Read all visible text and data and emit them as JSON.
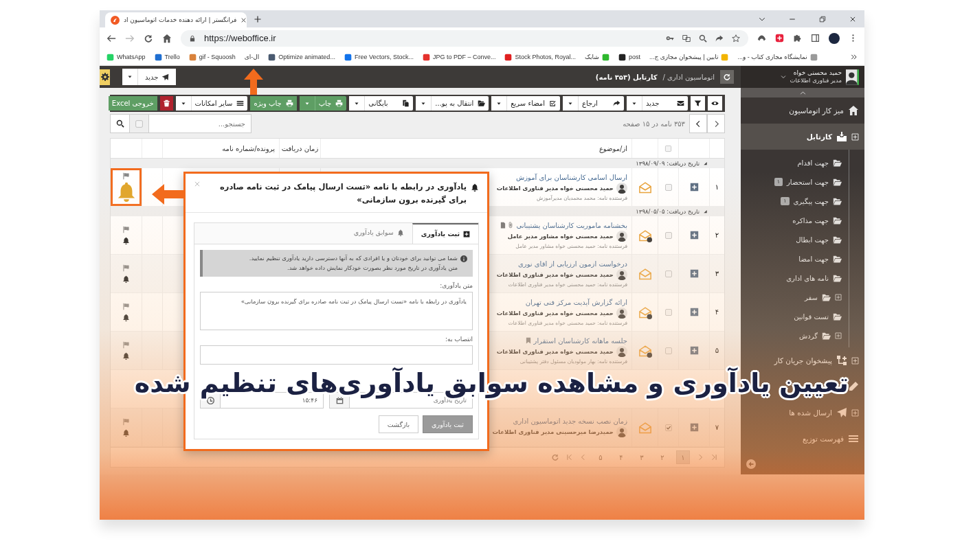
{
  "browser": {
    "tab": {
      "title": "فرانگستر | ارائه دهنده خدمات اتوماسیون اد",
      "selected": true
    },
    "url": "https://weboffice.ir",
    "bookmarks": [
      {
        "label": "نمایشگاه مجازی کتاب - و...",
        "color": "#9a9a9a"
      },
      {
        "label": "تابین | پیشخوان مجازی ج...",
        "color": "#f2b400"
      },
      {
        "label": "post",
        "color": "#222222"
      },
      {
        "label": "شابک",
        "color": "#2eb82e"
      },
      {
        "label": "Stock Photos, Royal...",
        "color": "#e02020"
      },
      {
        "label": "JPG to PDF – Conve...",
        "color": "#e5322d"
      },
      {
        "label": "Free Vectors, Stock...",
        "color": "#1273eb"
      },
      {
        "label": "Optimize animated...",
        "color": "#4a5a70"
      },
      {
        "label": "ال-ای"
      },
      {
        "label": "gif - Squoosh",
        "color": "#d9823b"
      },
      {
        "label": "Trello",
        "color": "#1f6fd1"
      },
      {
        "label": "WhatsApp",
        "color": "#25d366"
      }
    ]
  },
  "app": {
    "user": {
      "name": "حمید محسنی خواه",
      "role": "مدیر فناوری اطلاعات"
    },
    "new_button": {
      "label": "جدید"
    },
    "breadcrumb": {
      "parent": "اتوماسیون اداری /",
      "current": "کارتابل (۳۵۳ نامه)"
    },
    "sidebar": [
      {
        "kind": "home",
        "label": "میز کار اتوماسیون",
        "selected": false,
        "expandable": false
      },
      {
        "kind": "inbox",
        "label": "کارتابل",
        "selected": true,
        "expandable": true,
        "expanded": true,
        "children": [
          {
            "label": "جهت اقدام",
            "expandable": false
          },
          {
            "label": "جهت استحضار",
            "badge": "۱",
            "expandable": false
          },
          {
            "label": "جهت پیگیری",
            "badge": "۱",
            "expandable": false
          },
          {
            "label": "جهت مذاکره",
            "expandable": false
          },
          {
            "label": "جهت ابطال",
            "expandable": false
          },
          {
            "label": "جهت امضا",
            "expandable": false
          },
          {
            "label": "نامه های اداری",
            "expandable": false
          },
          {
            "label": "سفر",
            "expandable": true
          },
          {
            "label": "تست قوانین",
            "expandable": false
          },
          {
            "label": "گردش",
            "expandable": true
          }
        ]
      },
      {
        "kind": "workflow",
        "label": "پیشخوان جریان کار",
        "selected": false,
        "expandable": true
      },
      {
        "kind": "drafts",
        "selected": false,
        "expandable": false
      },
      {
        "kind": "sent",
        "label": "ارسال شده ها",
        "selected": false,
        "expandable": true
      },
      {
        "kind": "list",
        "label": "فهرست توزیع",
        "selected": false,
        "expandable": false
      }
    ],
    "toolbar": [
      {
        "kind": "view",
        "dropdown": false
      },
      {
        "kind": "filter",
        "dropdown": false
      },
      {
        "kind": "new",
        "label": "جدید",
        "dropdown": true
      },
      {
        "kind": "refer",
        "label": "ارجاع",
        "dropdown": true
      },
      {
        "kind": "sign",
        "label": "امضاء سریع",
        "dropdown": true
      },
      {
        "kind": "move",
        "label": "انتقال به پو...",
        "dropdown": true
      },
      {
        "kind": "archive",
        "label": "بایگانی",
        "dropdown": true
      },
      {
        "kind": "print",
        "label": "چاپ",
        "dropdown": true
      },
      {
        "kind": "special-print",
        "label": "چاپ ویژه",
        "dropdown": false
      },
      {
        "kind": "more",
        "label": "سایر امکانات",
        "dropdown": true
      },
      {
        "kind": "delete",
        "dropdown": false
      },
      {
        "kind": "export",
        "label": "خروجی Excel",
        "dropdown": false
      }
    ],
    "pager": {
      "summary": "۳۵۳ نامه در ۱۵ صفحه"
    },
    "search": {
      "placeholder": "جستجو..."
    },
    "select_all": {
      "checked": false
    },
    "columns": [
      "از/موضوع",
      "زمان دریافت",
      "پرونده/شماره نامه"
    ],
    "groups": [
      {
        "label": "تاریخ دریافت: ۱۳۹۸/۰۹/۰۹",
        "rows": [
          {
            "kind": "letter",
            "number": "۱",
            "subject": "ارسال اسامی کارشناسان برای آموزش",
            "from": "حمید محسنی خواه مدیر فناوری اطلاعات",
            "sender": "فرستنده نامه: محمد محمدیان مدیرآموزش",
            "checked": false,
            "pending": false,
            "attachment": false,
            "bookmarked": false,
            "reminder_set": true
          }
        ]
      },
      {
        "label": "تاریخ دریافت: ۱۳۹۸/۰۵/۰۵",
        "rows": [
          {
            "kind": "letter",
            "number": "۲",
            "subject": "بخشنامه ماموریت کارشناسان پشتیبانی",
            "from": "حمید محسنی خواه مشاور مدیر عامل",
            "sender": "فرستنده نامه: حمید محسنی خواه مشاور مدیر عامل",
            "checked": false,
            "pending": true,
            "attachment": true,
            "bookmarked": false,
            "reminder_set": false
          },
          {
            "kind": "letter",
            "number": "۳",
            "subject": "درخواست ازمون ارزیابی از اقای نوری",
            "from": "حمید محسنی خواه مدیر فناوری اطلاعات",
            "sender": "فرستنده نامه: حمید محسنی خواه مدیر فناوری اطلاعات",
            "checked": false,
            "pending": false,
            "attachment": false,
            "bookmarked": false,
            "reminder_set": false
          },
          {
            "kind": "letter",
            "number": "۴",
            "subject": "ارائه گزارش آپدیت مرکز فنی تهران",
            "from": "حمید محسنی خواه مدیر فناوری اطلاعات",
            "sender": "فرستنده نامه: حمید محسنی خواه مدیر فناوری اطلاعات",
            "checked": false,
            "pending": true,
            "attachment": false,
            "bookmarked": false,
            "reminder_set": false
          },
          {
            "kind": "letter",
            "number": "۵",
            "subject": "جلسه ماهانه کارشناسان استقرار",
            "from": "حمید محسنی خواه مدیر فناوری اطلاعات",
            "sender": "فرستنده نامه: بهار مولودیان مسئول دفتر پشتیبانی",
            "checked": false,
            "pending": true,
            "attachment": false,
            "bookmarked": true,
            "reminder_set": false
          },
          {
            "kind": "covered"
          },
          {
            "kind": "letter",
            "number": "۷",
            "subject": "زمان نصب نسخه جدید اتوماسیون اداری",
            "from": "حمیدرضا میرحسینی مدیر فناوری اطلاعات",
            "checked": true,
            "pending": false,
            "attachment": false,
            "bookmarked": false,
            "reminder_set": false
          }
        ]
      }
    ],
    "pages": [
      {
        "label": "۱",
        "selected": true
      },
      {
        "label": "۲",
        "selected": false
      },
      {
        "label": "۳",
        "selected": false
      },
      {
        "label": "۴",
        "selected": false
      },
      {
        "label": "۵",
        "selected": false
      }
    ]
  },
  "modal": {
    "title": "یادآوری در رابطه با نامه «تست ارسال پیامک در ثبت نامه صادره برای گیرنده برون سازمانی»",
    "tabs": [
      {
        "label": "ثبت یادآوری",
        "selected": true
      },
      {
        "label": "سوابق یادآوری",
        "selected": false
      }
    ],
    "info": [
      "شما می توانید برای خودتان و یا افرادی که به آنها دسترسی دارید یادآوری تنظیم نمایید.",
      "متن یادآوری در تاریخ مورد نظر بصورت خودکار نمایش داده خواهد شد."
    ],
    "text_label": "متن یادآوری:",
    "text_value": "یادآوری در رابطه با نامه «تست ارسال پیامک در ثبت نامه صادره برای گیرنده برون سازمانی»",
    "assign_label": "انتصاب به:",
    "date": {
      "placeholder": "تاریخ یادآوری"
    },
    "time": {
      "value": "۱۵:۴۶"
    },
    "buttons": [
      {
        "kind": "primary",
        "label": "ثبت یادآوری"
      },
      {
        "kind": "secondary",
        "label": "بازگشت"
      }
    ]
  },
  "caption": "تعیین یادآوری و مشاهده سوابق یادآوری‌های تنظیم شده"
}
